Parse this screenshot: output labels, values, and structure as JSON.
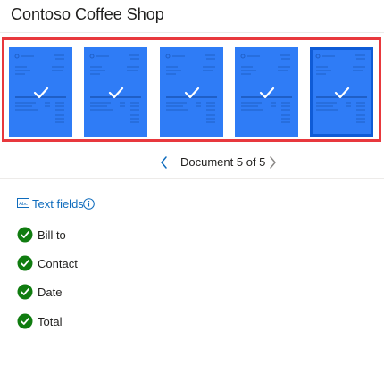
{
  "header": {
    "title": "Contoso Coffee Shop"
  },
  "thumbnails": [
    {
      "status": "checked",
      "selected": false
    },
    {
      "status": "checked",
      "selected": false
    },
    {
      "status": "checked",
      "selected": false
    },
    {
      "status": "checked",
      "selected": false
    },
    {
      "status": "checked",
      "selected": true
    }
  ],
  "pager": {
    "label": "Document 5 of 5",
    "current": 5,
    "total": 5
  },
  "text_fields": {
    "heading": "Text fields",
    "icon": "abc-icon",
    "info_icon": "info-icon",
    "items": [
      {
        "label": "Bill to",
        "status": "valid"
      },
      {
        "label": "Contact",
        "status": "valid"
      },
      {
        "label": "Date",
        "status": "valid"
      },
      {
        "label": "Total",
        "status": "valid"
      }
    ]
  },
  "colors": {
    "thumbnail": "#2f7cf6",
    "selected_border": "#0f5bd6",
    "highlight_frame": "#e8383d",
    "link": "#0f6cbd",
    "success": "#107c10"
  }
}
